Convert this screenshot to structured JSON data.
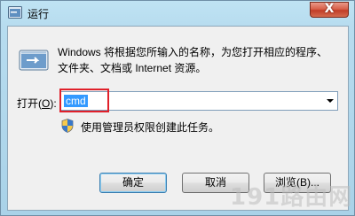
{
  "window": {
    "title": "运行",
    "close_label": "X"
  },
  "dialog": {
    "description_line1": "Windows 将根据您所输入的名称，为您打开相应的程序、",
    "description_line2": "文件夹、文档或 Internet 资源。",
    "open_label_prefix": "打开(",
    "open_label_key": "O",
    "open_label_suffix": "):",
    "command_value": "cmd",
    "admin_note": "使用管理员权限创建此任务。"
  },
  "buttons": {
    "ok": "确定",
    "cancel": "取消",
    "browse": "浏览(B)..."
  },
  "watermark": "191路由网",
  "colors": {
    "selection": "#3399ff",
    "highlight_box": "#e0202a",
    "close_button": "#c13e28"
  },
  "icons": {
    "title": "run-app-icon",
    "dialog": "run-app-icon",
    "admin": "uac-shield-icon",
    "dropdown": "chevron-down-icon"
  }
}
